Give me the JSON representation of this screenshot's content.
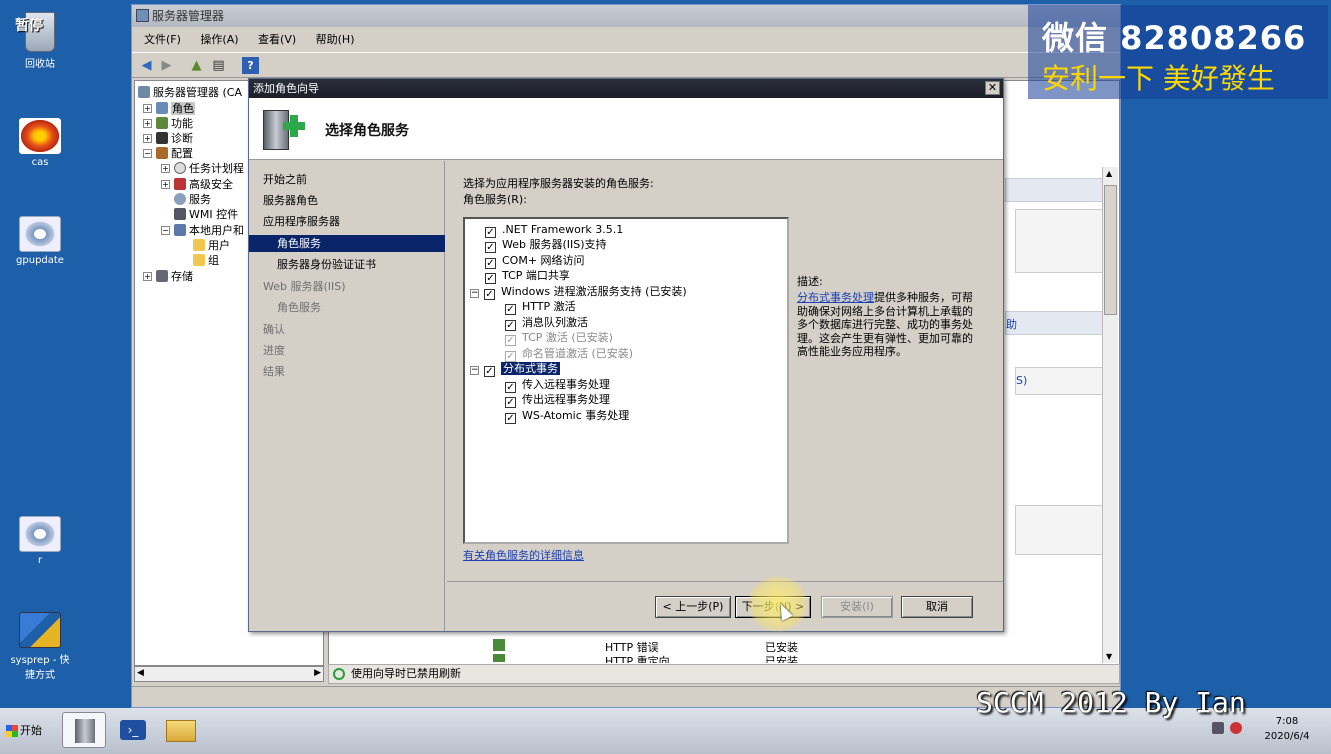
{
  "desktop": {
    "icons": [
      {
        "label": "回收站",
        "icon": "recycle-bin-icon"
      },
      {
        "label": "cas",
        "icon": "flower-image-icon"
      },
      {
        "label": "gpupdate",
        "icon": "gear-shortcut-icon"
      },
      {
        "label": "r",
        "icon": "gear-shortcut-icon"
      },
      {
        "label": "sysprep - 快捷方式",
        "icon": "network-shortcut-icon"
      }
    ],
    "pause_label": "暂停"
  },
  "server_manager": {
    "title": "服务器管理器",
    "menu": [
      "文件(F)",
      "操作(A)",
      "查看(V)",
      "帮助(H)"
    ],
    "tree": {
      "root": "服务器管理器 (CA",
      "items": [
        {
          "label": "角色",
          "level": 1,
          "expander": "+",
          "selected": true
        },
        {
          "label": "功能",
          "level": 1,
          "expander": "+"
        },
        {
          "label": "诊断",
          "level": 1,
          "expander": "+"
        },
        {
          "label": "配置",
          "level": 1,
          "expander": "−"
        },
        {
          "label": "任务计划程",
          "level": 2,
          "expander": "+"
        },
        {
          "label": "高级安全",
          "level": 2,
          "expander": "+"
        },
        {
          "label": "服务",
          "level": 2,
          "expander": ""
        },
        {
          "label": "WMI 控件",
          "level": 2,
          "expander": ""
        },
        {
          "label": "本地用户和",
          "level": 2,
          "expander": "−"
        },
        {
          "label": "用户",
          "level": 3,
          "expander": ""
        },
        {
          "label": "组",
          "level": 3,
          "expander": ""
        },
        {
          "label": "存储",
          "level": 1,
          "expander": "+"
        }
      ]
    },
    "right_fragments": {
      "help_link": "助",
      "s_fragment": "S)"
    },
    "bottom_list": [
      {
        "name": "HTTP 错误",
        "status": "已安装"
      },
      {
        "name": "HTTP 重定向",
        "status": "已安装"
      }
    ],
    "status_text": "使用向导时已禁用刷新"
  },
  "wizard": {
    "title": "添加角色向导",
    "heading": "选择角色服务",
    "nav": [
      {
        "label": "开始之前",
        "state": "normal"
      },
      {
        "label": "服务器角色",
        "state": "normal"
      },
      {
        "label": "应用程序服务器",
        "state": "normal"
      },
      {
        "label": "角色服务",
        "state": "selected"
      },
      {
        "label": "服务器身份验证证书",
        "state": "sub"
      },
      {
        "label": "Web 服务器(IIS)",
        "state": "disabled"
      },
      {
        "label": "角色服务",
        "state": "disabled-sub"
      },
      {
        "label": "确认",
        "state": "disabled"
      },
      {
        "label": "进度",
        "state": "disabled"
      },
      {
        "label": "结果",
        "state": "disabled"
      }
    ],
    "instruction": "选择为应用程序服务器安装的角色服务:",
    "list_label": "角色服务(R):",
    "services": [
      {
        "label": ".NET Framework 3.5.1",
        "level": 0,
        "checked": true,
        "disabled": false,
        "expander": ""
      },
      {
        "label": "Web 服务器(IIS)支持",
        "level": 0,
        "checked": true,
        "disabled": false,
        "expander": ""
      },
      {
        "label": "COM+ 网络访问",
        "level": 0,
        "checked": true,
        "disabled": false,
        "expander": ""
      },
      {
        "label": "TCP 端口共享",
        "level": 0,
        "checked": true,
        "disabled": false,
        "expander": ""
      },
      {
        "label": "Windows 进程激活服务支持  (已安装)",
        "level": 0,
        "checked": true,
        "disabled": false,
        "expander": "−"
      },
      {
        "label": "HTTP 激活",
        "level": 1,
        "checked": true,
        "disabled": false,
        "expander": ""
      },
      {
        "label": "消息队列激活",
        "level": 1,
        "checked": true,
        "disabled": false,
        "expander": ""
      },
      {
        "label": "TCP 激活  (已安装)",
        "level": 1,
        "checked": true,
        "disabled": true,
        "expander": ""
      },
      {
        "label": "命名管道激活  (已安装)",
        "level": 1,
        "checked": true,
        "disabled": true,
        "expander": ""
      },
      {
        "label": "分布式事务",
        "level": 0,
        "checked": true,
        "disabled": false,
        "expander": "−",
        "highlight": true
      },
      {
        "label": "传入远程事务处理",
        "level": 1,
        "checked": true,
        "disabled": false,
        "expander": ""
      },
      {
        "label": "传出远程事务处理",
        "level": 1,
        "checked": true,
        "disabled": false,
        "expander": ""
      },
      {
        "label": "WS-Atomic 事务处理",
        "level": 1,
        "checked": true,
        "disabled": false,
        "expander": ""
      }
    ],
    "description_label": "描述:",
    "description_link": "分布式事务处理",
    "description_text": "提供多种服务，可帮助确保对网络上多台计算机上承载的多个数据库进行完整、成功的事务处理。这会产生更有弹性、更加可靠的高性能业务应用程序。",
    "more_info_link": "有关角色服务的详细信息",
    "buttons": {
      "back": "< 上一步(P)",
      "next": "下一步(N) >",
      "install": "安装(I)",
      "cancel": "取消"
    }
  },
  "taskbar": {
    "start_label": "开始",
    "time": "7:08",
    "date": "2020/6/4"
  },
  "overlays": {
    "watermark_line1": "微信 82808266",
    "watermark_line2": "安利一下 美好發生",
    "caption": "SCCM 2012 By Ian"
  }
}
